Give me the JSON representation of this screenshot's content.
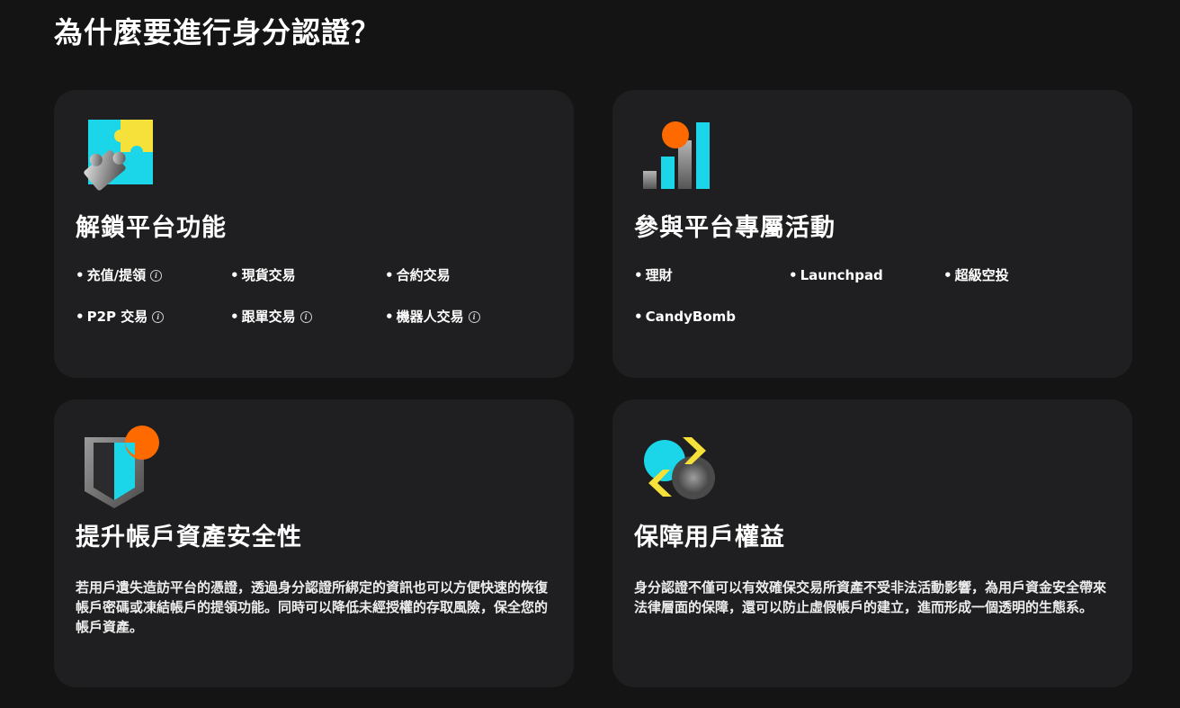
{
  "page": {
    "title": "為什麼要進行身分認證？"
  },
  "colors": {
    "background": "#141415",
    "card": "#1f1f21",
    "cyan": "#1ad6e8",
    "yellow": "#f5e13a",
    "orange": "#ff6a00",
    "gray": "#8c8c8c"
  },
  "cards": [
    {
      "title": "解鎖平台功能",
      "icon": "puzzle-icon",
      "features": [
        {
          "label": "充值/提領",
          "info": true
        },
        {
          "label": "現貨交易",
          "info": false
        },
        {
          "label": "合約交易",
          "info": false
        },
        {
          "label": "P2P 交易",
          "info": true
        },
        {
          "label": "跟單交易",
          "info": true
        },
        {
          "label": "機器人交易",
          "info": true
        }
      ]
    },
    {
      "title": "參與平台專屬活動",
      "icon": "bar-chart-icon",
      "features": [
        {
          "label": "理財",
          "info": false
        },
        {
          "label": "Launchpad",
          "info": false
        },
        {
          "label": "超級空投",
          "info": false
        },
        {
          "label": "CandyBomb",
          "info": false
        }
      ]
    },
    {
      "title": "提升帳戶資產安全性",
      "icon": "shield-icon",
      "description": "若用戶遺失造訪平台的憑證，透過身分認證所綁定的資訊也可以方便快速的恢復帳戶密碼或凍結帳戶的提領功能。同時可以降低未經授權的存取風險，保全您的帳戶資產。"
    },
    {
      "title": "保障用戶權益",
      "icon": "exchange-icon",
      "description": "身分認證不僅可以有效確保交易所資產不受非法活動影響，為用戶資金安全帶來法律層面的保障，還可以防止虛假帳戶的建立，進而形成一個透明的生態系。"
    }
  ]
}
